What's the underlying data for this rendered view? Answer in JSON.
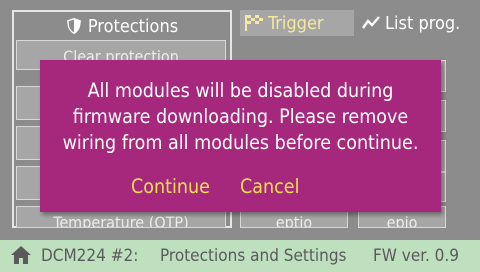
{
  "tabs": [
    {
      "label": "Protections",
      "icon": "shield-icon"
    },
    {
      "label": "Trigger",
      "icon": "checkered-flag-icon"
    },
    {
      "label": "List prog.",
      "icon": "zigzag-icon"
    }
  ],
  "protections_panel": {
    "clear_protection_label": "Clear protection",
    "temperature_label": "Temperature (OTP)"
  },
  "background_partial": {
    "right_label": "re",
    "bottom_label_1": "eptio",
    "bottom_label_2": "epio"
  },
  "dialog": {
    "message_line1": "All modules will be disabled during",
    "message_line2": "firmware downloading. Please remove",
    "message_line3": "wiring from all modules before continue.",
    "continue_label": "Continue",
    "cancel_label": "Cancel"
  },
  "status_bar": {
    "home_icon": "home-icon",
    "device": "DCM224 #2:",
    "page": "Protections and Settings",
    "firmware": "FW ver. 0.9"
  },
  "colors": {
    "dialog_bg": "#a6287d",
    "dialog_action": "#f5e050",
    "status_bg": "#bfe0bf",
    "screen_bg": "#8c8c8c"
  }
}
